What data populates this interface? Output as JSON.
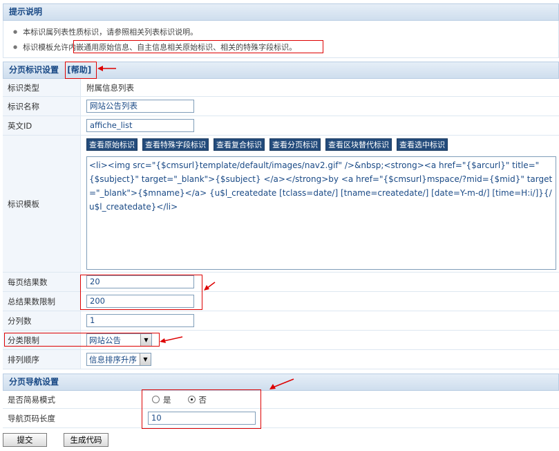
{
  "tips": {
    "header": "提示说明",
    "items": [
      "本标识属列表性质标识，请参照相关列表标识说明。",
      "标识模板允许内嵌通用原始信息、自主信息相关原始标识、相关的特殊字段标识。"
    ]
  },
  "settings": {
    "header": "分页标识设置",
    "help_link": "[帮助]",
    "type_label": "标识类型",
    "type_value": "附属信息列表",
    "name_label": "标识名称",
    "name_value": "网站公告列表",
    "en_id_label": "英文ID",
    "en_id_value": "affiche_list",
    "template_label": "标识模板",
    "template_buttons": [
      "查看原始标识",
      "查看特殊字段标识",
      "查看复合标识",
      "查看分页标识",
      "查看区块替代标识",
      "查看选中标识"
    ],
    "template_value": "<li><img src=\"{$cmsurl}template/default/images/nav2.gif\" />&nbsp;<strong><a href=\"{$arcurl}\" title=\"{$subject}\"  target=\"_blank\">{$subject} </a></strong>by <a href=\"{$cmsurl}mspace/?mid={$mid}\" target=\"_blank\">{$mname}</a> {u$l_createdate [tclass=date/] [tname=createdate/] [date=Y-m-d/] [time=H:i/]}{/u$l_createdate}</li>",
    "per_page_label": "每页结果数",
    "per_page_value": "20",
    "total_limit_label": "总结果数限制",
    "total_limit_value": "200",
    "columns_label": "分列数",
    "columns_value": "1",
    "category_label": "分类限制",
    "category_value": "网站公告",
    "order_label": "排列顺序",
    "order_value": "信息排序升序"
  },
  "nav": {
    "header": "分页导航设置",
    "simple_label": "是否简易模式",
    "opt_yes": "是",
    "opt_no": "否",
    "simple_selected": "否",
    "length_label": "导航页码长度",
    "length_value": "10"
  },
  "actions": {
    "submit": "提交",
    "generate": "生成代码"
  },
  "colors": {
    "accent": "#1a4a86",
    "annotation": "#dd0000",
    "button_dark": "#244c7c"
  }
}
